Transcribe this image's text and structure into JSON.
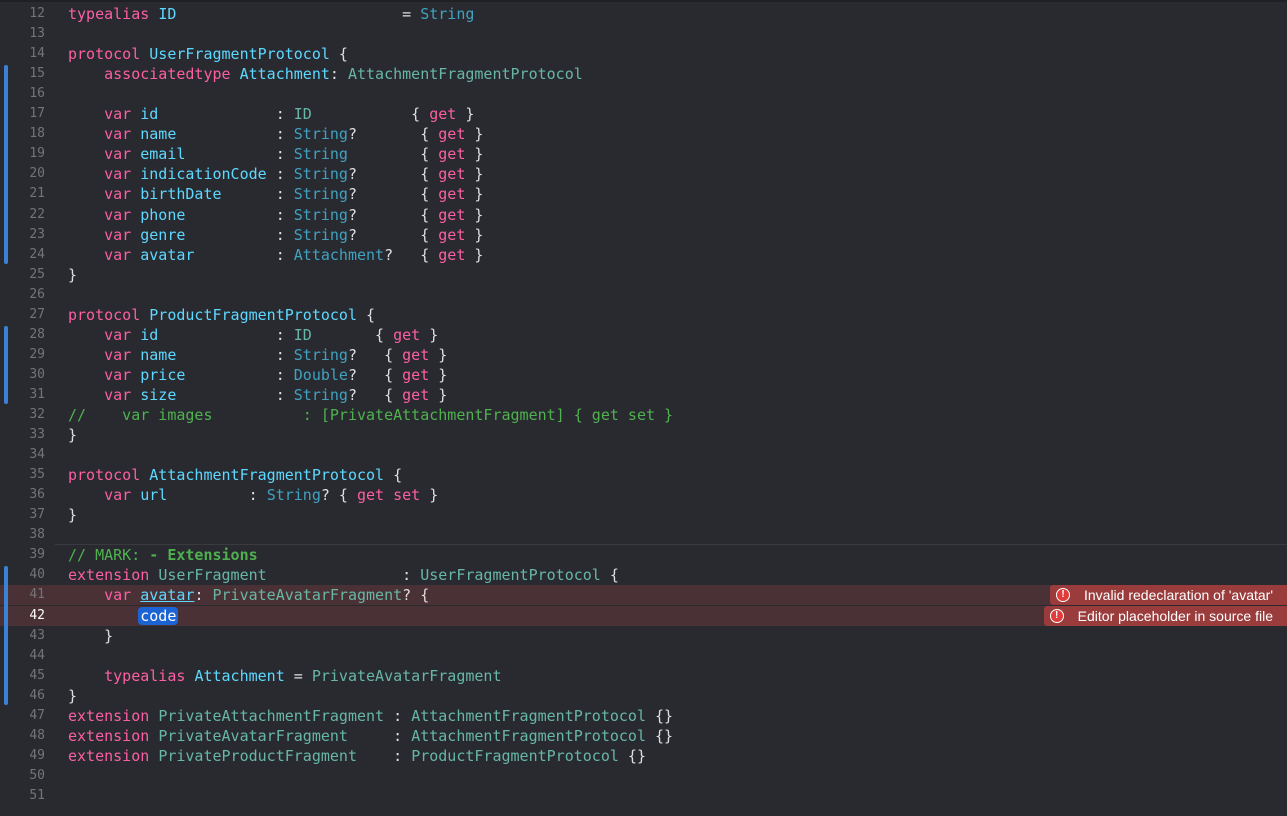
{
  "editor": {
    "lines": [
      {
        "n": "12",
        "tokens": [
          {
            "t": "typealias",
            "c": "kw"
          },
          {
            "t": " "
          },
          {
            "t": "ID",
            "c": "tyd"
          },
          {
            "t": "                         = "
          },
          {
            "t": "String",
            "c": "ty"
          }
        ]
      },
      {
        "n": "13",
        "tokens": []
      },
      {
        "n": "14",
        "tokens": [
          {
            "t": "protocol",
            "c": "kw"
          },
          {
            "t": " "
          },
          {
            "t": "UserFragmentProtocol",
            "c": "tyd"
          },
          {
            "t": " {"
          }
        ]
      },
      {
        "n": "15",
        "tokens": [
          {
            "t": "    "
          },
          {
            "t": "associatedtype",
            "c": "kw"
          },
          {
            "t": " "
          },
          {
            "t": "Attachment",
            "c": "tyd"
          },
          {
            "t": ": "
          },
          {
            "t": "AttachmentFragmentProtocol",
            "c": "pl"
          }
        ]
      },
      {
        "n": "16",
        "tokens": []
      },
      {
        "n": "17",
        "tokens": [
          {
            "t": "    "
          },
          {
            "t": "var",
            "c": "kw"
          },
          {
            "t": " "
          },
          {
            "t": "id",
            "c": "tyd"
          },
          {
            "t": "             : "
          },
          {
            "t": "ID",
            "c": "pl"
          },
          {
            "t": "           { "
          },
          {
            "t": "get",
            "c": "kw"
          },
          {
            "t": " }"
          }
        ]
      },
      {
        "n": "18",
        "tokens": [
          {
            "t": "    "
          },
          {
            "t": "var",
            "c": "kw"
          },
          {
            "t": " "
          },
          {
            "t": "name",
            "c": "tyd"
          },
          {
            "t": "           : "
          },
          {
            "t": "String",
            "c": "ty"
          },
          {
            "t": "?       { "
          },
          {
            "t": "get",
            "c": "kw"
          },
          {
            "t": " }"
          }
        ]
      },
      {
        "n": "19",
        "tokens": [
          {
            "t": "    "
          },
          {
            "t": "var",
            "c": "kw"
          },
          {
            "t": " "
          },
          {
            "t": "email",
            "c": "tyd"
          },
          {
            "t": "          : "
          },
          {
            "t": "String",
            "c": "ty"
          },
          {
            "t": "        { "
          },
          {
            "t": "get",
            "c": "kw"
          },
          {
            "t": " }"
          }
        ]
      },
      {
        "n": "20",
        "tokens": [
          {
            "t": "    "
          },
          {
            "t": "var",
            "c": "kw"
          },
          {
            "t": " "
          },
          {
            "t": "indicationCode",
            "c": "tyd"
          },
          {
            "t": " : "
          },
          {
            "t": "String",
            "c": "ty"
          },
          {
            "t": "?       { "
          },
          {
            "t": "get",
            "c": "kw"
          },
          {
            "t": " }"
          }
        ]
      },
      {
        "n": "21",
        "tokens": [
          {
            "t": "    "
          },
          {
            "t": "var",
            "c": "kw"
          },
          {
            "t": " "
          },
          {
            "t": "birthDate",
            "c": "tyd"
          },
          {
            "t": "      : "
          },
          {
            "t": "String",
            "c": "ty"
          },
          {
            "t": "?       { "
          },
          {
            "t": "get",
            "c": "kw"
          },
          {
            "t": " }"
          }
        ]
      },
      {
        "n": "22",
        "tokens": [
          {
            "t": "    "
          },
          {
            "t": "var",
            "c": "kw"
          },
          {
            "t": " "
          },
          {
            "t": "phone",
            "c": "tyd"
          },
          {
            "t": "          : "
          },
          {
            "t": "String",
            "c": "ty"
          },
          {
            "t": "?       { "
          },
          {
            "t": "get",
            "c": "kw"
          },
          {
            "t": " }"
          }
        ]
      },
      {
        "n": "23",
        "tokens": [
          {
            "t": "    "
          },
          {
            "t": "var",
            "c": "kw"
          },
          {
            "t": " "
          },
          {
            "t": "genre",
            "c": "tyd"
          },
          {
            "t": "          : "
          },
          {
            "t": "String",
            "c": "ty"
          },
          {
            "t": "?       { "
          },
          {
            "t": "get",
            "c": "kw"
          },
          {
            "t": " }"
          }
        ]
      },
      {
        "n": "24",
        "tokens": [
          {
            "t": "    "
          },
          {
            "t": "var",
            "c": "kw"
          },
          {
            "t": " "
          },
          {
            "t": "avatar",
            "c": "tyd"
          },
          {
            "t": "         : "
          },
          {
            "t": "Attachment",
            "c": "ty"
          },
          {
            "t": "?   { "
          },
          {
            "t": "get",
            "c": "kw"
          },
          {
            "t": " }"
          }
        ]
      },
      {
        "n": "25",
        "tokens": [
          {
            "t": "}"
          }
        ]
      },
      {
        "n": "26",
        "tokens": []
      },
      {
        "n": "27",
        "tokens": [
          {
            "t": "protocol",
            "c": "kw"
          },
          {
            "t": " "
          },
          {
            "t": "ProductFragmentProtocol",
            "c": "tyd"
          },
          {
            "t": " {"
          }
        ]
      },
      {
        "n": "28",
        "tokens": [
          {
            "t": "    "
          },
          {
            "t": "var",
            "c": "kw"
          },
          {
            "t": " "
          },
          {
            "t": "id",
            "c": "tyd"
          },
          {
            "t": "             : "
          },
          {
            "t": "ID",
            "c": "pl"
          },
          {
            "t": "       { "
          },
          {
            "t": "get",
            "c": "kw"
          },
          {
            "t": " }"
          }
        ]
      },
      {
        "n": "29",
        "tokens": [
          {
            "t": "    "
          },
          {
            "t": "var",
            "c": "kw"
          },
          {
            "t": " "
          },
          {
            "t": "name",
            "c": "tyd"
          },
          {
            "t": "           : "
          },
          {
            "t": "String",
            "c": "ty"
          },
          {
            "t": "?   { "
          },
          {
            "t": "get",
            "c": "kw"
          },
          {
            "t": " }"
          }
        ]
      },
      {
        "n": "30",
        "tokens": [
          {
            "t": "    "
          },
          {
            "t": "var",
            "c": "kw"
          },
          {
            "t": " "
          },
          {
            "t": "price",
            "c": "tyd"
          },
          {
            "t": "          : "
          },
          {
            "t": "Double",
            "c": "ty"
          },
          {
            "t": "?   { "
          },
          {
            "t": "get",
            "c": "kw"
          },
          {
            "t": " }"
          }
        ]
      },
      {
        "n": "31",
        "tokens": [
          {
            "t": "    "
          },
          {
            "t": "var",
            "c": "kw"
          },
          {
            "t": " "
          },
          {
            "t": "size",
            "c": "tyd"
          },
          {
            "t": "           : "
          },
          {
            "t": "String",
            "c": "ty"
          },
          {
            "t": "?   { "
          },
          {
            "t": "get",
            "c": "kw"
          },
          {
            "t": " }"
          }
        ]
      },
      {
        "n": "32",
        "tokens": [
          {
            "t": "//    var images          : [PrivateAttachmentFragment] { get set }",
            "c": "cm2"
          }
        ]
      },
      {
        "n": "33",
        "tokens": [
          {
            "t": "}"
          }
        ]
      },
      {
        "n": "34",
        "tokens": []
      },
      {
        "n": "35",
        "tokens": [
          {
            "t": "protocol",
            "c": "kw"
          },
          {
            "t": " "
          },
          {
            "t": "AttachmentFragmentProtocol",
            "c": "tyd"
          },
          {
            "t": " {"
          }
        ]
      },
      {
        "n": "36",
        "tokens": [
          {
            "t": "    "
          },
          {
            "t": "var",
            "c": "kw"
          },
          {
            "t": " "
          },
          {
            "t": "url",
            "c": "tyd"
          },
          {
            "t": "         : "
          },
          {
            "t": "String",
            "c": "ty"
          },
          {
            "t": "? { "
          },
          {
            "t": "get",
            "c": "kw"
          },
          {
            "t": " "
          },
          {
            "t": "set",
            "c": "kw"
          },
          {
            "t": " }"
          }
        ]
      },
      {
        "n": "37",
        "tokens": [
          {
            "t": "}"
          }
        ]
      },
      {
        "n": "38",
        "tokens": []
      },
      {
        "n": "39",
        "tokens": [
          {
            "t": "// MARK: ",
            "c": "cm2"
          },
          {
            "t": "- Extensions",
            "c": "mk"
          }
        ]
      },
      {
        "n": "40",
        "tokens": [
          {
            "t": "extension",
            "c": "kw"
          },
          {
            "t": " "
          },
          {
            "t": "UserFragment",
            "c": "pl"
          },
          {
            "t": "               : "
          },
          {
            "t": "UserFragmentProtocol",
            "c": "pl"
          },
          {
            "t": " {"
          }
        ]
      },
      {
        "n": "41",
        "tokens": [
          {
            "t": "    "
          },
          {
            "t": "var",
            "c": "kw"
          },
          {
            "t": " "
          },
          {
            "t": "avatar",
            "c": "tyd ul"
          },
          {
            "t": ": "
          },
          {
            "t": "PrivateAvatarFragment",
            "c": "pl"
          },
          {
            "t": "? {"
          }
        ]
      },
      {
        "n": "42",
        "tokens": [
          {
            "t": "        "
          },
          {
            "t": "code",
            "c": "ph"
          }
        ]
      },
      {
        "n": "43",
        "tokens": [
          {
            "t": "    }"
          }
        ]
      },
      {
        "n": "44",
        "tokens": []
      },
      {
        "n": "45",
        "tokens": [
          {
            "t": "    "
          },
          {
            "t": "typealias",
            "c": "kw"
          },
          {
            "t": " "
          },
          {
            "t": "Attachment",
            "c": "tyd"
          },
          {
            "t": " = "
          },
          {
            "t": "PrivateAvatarFragment",
            "c": "pl"
          }
        ]
      },
      {
        "n": "46",
        "tokens": [
          {
            "t": "}"
          }
        ]
      },
      {
        "n": "47",
        "tokens": [
          {
            "t": "extension",
            "c": "kw"
          },
          {
            "t": " "
          },
          {
            "t": "PrivateAttachmentFragment",
            "c": "pl"
          },
          {
            "t": " : "
          },
          {
            "t": "AttachmentFragmentProtocol",
            "c": "pl"
          },
          {
            "t": " {}"
          }
        ]
      },
      {
        "n": "48",
        "tokens": [
          {
            "t": "extension",
            "c": "kw"
          },
          {
            "t": " "
          },
          {
            "t": "PrivateAvatarFragment",
            "c": "pl"
          },
          {
            "t": "     : "
          },
          {
            "t": "AttachmentFragmentProtocol",
            "c": "pl"
          },
          {
            "t": " {}"
          }
        ]
      },
      {
        "n": "49",
        "tokens": [
          {
            "t": "extension",
            "c": "kw"
          },
          {
            "t": " "
          },
          {
            "t": "PrivateProductFragment",
            "c": "pl"
          },
          {
            "t": "    : "
          },
          {
            "t": "ProductFragmentProtocol",
            "c": "pl"
          },
          {
            "t": " {}"
          }
        ]
      },
      {
        "n": "50",
        "tokens": []
      },
      {
        "n": "51",
        "tokens": []
      }
    ],
    "errors": [
      {
        "line": "41",
        "message": "Invalid redeclaration of 'avatar'"
      },
      {
        "line": "42",
        "message": "Editor placeholder in source file"
      }
    ],
    "current_line": "42"
  },
  "colors": {
    "background": "#292a30",
    "keyword": "#fc5fa3",
    "type_decl": "#5dd8ff",
    "type": "#41a1c0",
    "comment": "#4fb24f",
    "error": "#9a3c3c"
  },
  "icons": {
    "error": "error-icon"
  }
}
